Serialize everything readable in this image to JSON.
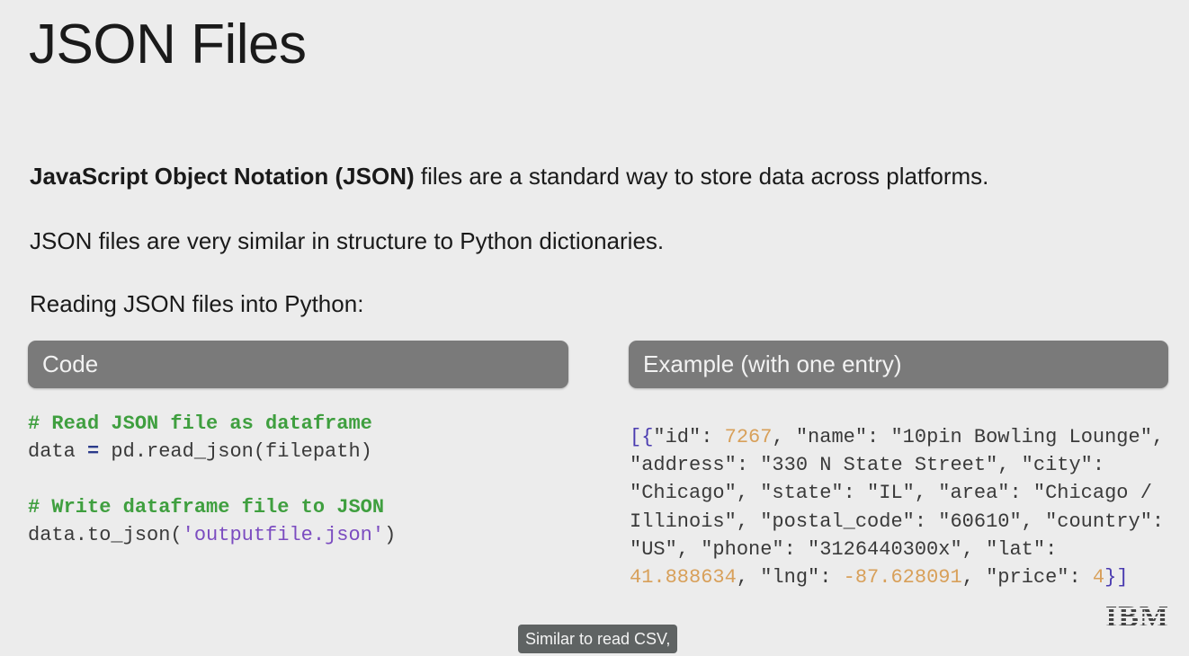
{
  "slide": {
    "title": "JSON Files",
    "para1_bold": "JavaScript Object Notation (JSON)",
    "para1_rest": " files are a standard way to store data across platforms.",
    "para2": "JSON files are very similar in structure to Python dictionaries.",
    "para3": "Reading JSON files into Python:"
  },
  "code_panel": {
    "header": "Code",
    "comment1": "# Read JSON file as dataframe",
    "line1_a": "data ",
    "line1_op": "=",
    "line1_b": " pd.read_json(filepath)",
    "comment2": "# Write dataframe file to JSON",
    "line2_a": "data.to_json(",
    "line2_str": "'outputfile.json'",
    "line2_b": ")"
  },
  "example_panel": {
    "header": "Example (with one entry)",
    "open_bracket": "[{",
    "part1": "\"id\": ",
    "id_value": "7267",
    "part2": ", \"name\": \"10pin Bowling Lounge\", \"address\": \"330 N State Street\", \"city\": \"Chicago\", \"state\": \"IL\", \"area\": \"Chicago / Illinois\", \"postal_code\": \"60610\", \"country\": \"US\", \"phone\": \"3126440300x\", \"lat\": ",
    "lat_value": "41.888634",
    "part3": ", \"lng\": ",
    "lng_value": "-87.628091",
    "part4": ", \"price\": ",
    "price_value": "4",
    "close_bracket": "}]"
  },
  "logo_text": "IBM",
  "caption": "Similar to read CSV,"
}
